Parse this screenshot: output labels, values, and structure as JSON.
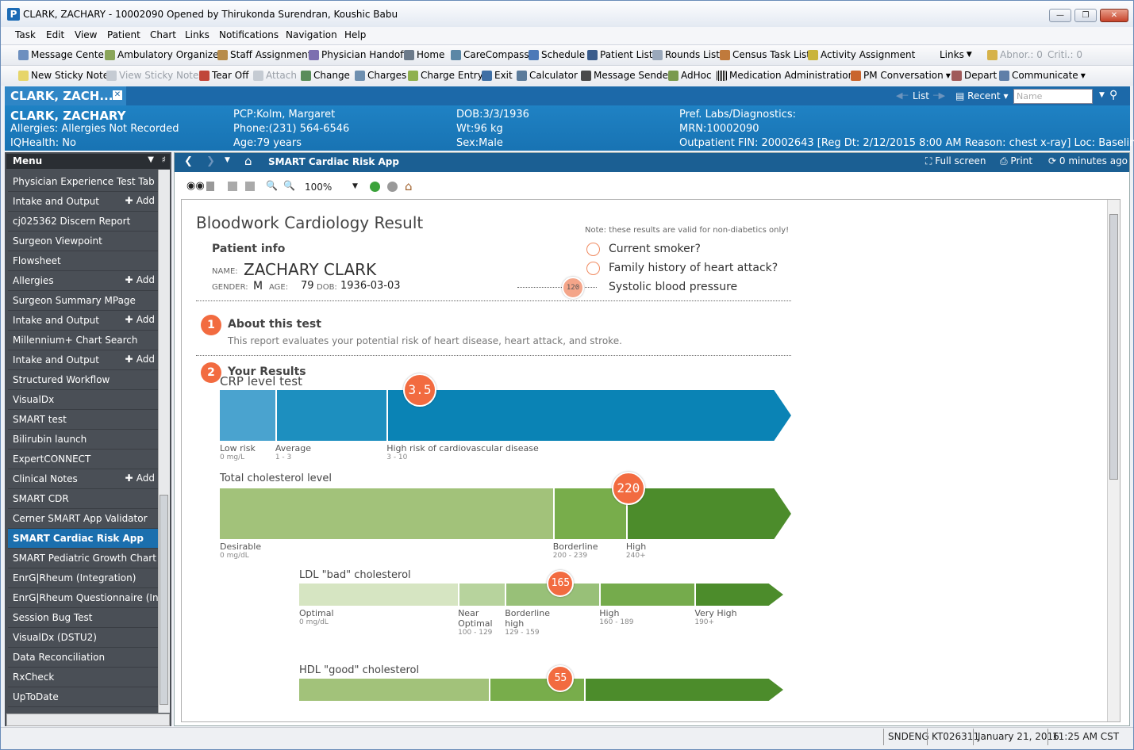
{
  "window": {
    "title": "CLARK, ZACHARY  - 10002090 Opened by Thirukonda Surendran, Koushic Babu",
    "app_icon": "P"
  },
  "menubar": [
    "Task",
    "Edit",
    "View",
    "Patient",
    "Chart",
    "Links",
    "Notifications",
    "Navigation",
    "Help"
  ],
  "toolbar1": [
    "Message Center",
    "Ambulatory Organizer",
    "Staff Assignment",
    "Physician Handoff",
    "Home",
    "CareCompass",
    "Schedule",
    "Patient List",
    "Rounds List",
    "Census Task List",
    "Activity Assignment",
    "Links",
    "Abnor.: 0",
    "Criti.: 0"
  ],
  "toolbar2": [
    "New Sticky Note",
    "View Sticky Notes",
    "Tear Off",
    "Attach",
    "Change",
    "Charges",
    "Charge Entry",
    "Exit",
    "Calculator",
    "Message Sender",
    "AdHoc",
    "Medication Administration",
    "PM Conversation",
    "Depart",
    "Communicate"
  ],
  "patient_tab": {
    "label": "CLARK, ZACH...",
    "list": "List",
    "recent": "Recent",
    "name_placeholder": "Name"
  },
  "banner": {
    "name": "CLARK, ZACHARY",
    "allergies": "Allergies: Allergies Not Recorded",
    "iqhealth": "IQHealth: No",
    "pcp": "PCP:Kolm, Margaret",
    "phone": "Phone:(231) 564-6546",
    "age": "Age:79 years",
    "dob": "DOB:3/3/1936",
    "wt": "Wt:96 kg",
    "sex": "Sex:Male",
    "labs": "Pref. Labs/Diagnostics:",
    "mrn": "MRN:10002090",
    "visit": "Outpatient  FIN: 20002643 [Reg Dt: 2/12/2015 8:00 AM Reason: chest x-ray] Loc: Baseline East"
  },
  "sidebar": {
    "header": "Menu",
    "items": [
      {
        "label": "Physician Experience Test Tab",
        "add": ""
      },
      {
        "label": "Intake and Output",
        "add": "Add"
      },
      {
        "label": "cj025362 Discern Report",
        "add": ""
      },
      {
        "label": "Surgeon Viewpoint",
        "add": ""
      },
      {
        "label": "Flowsheet",
        "add": ""
      },
      {
        "label": "Allergies",
        "add": "Add"
      },
      {
        "label": "Surgeon Summary MPage",
        "add": ""
      },
      {
        "label": "Intake and Output",
        "add": "Add"
      },
      {
        "label": "Millennium+ Chart Search",
        "add": ""
      },
      {
        "label": "Intake and Output",
        "add": "Add"
      },
      {
        "label": "Structured Workflow",
        "add": ""
      },
      {
        "label": "VisualDx",
        "add": ""
      },
      {
        "label": "SMART test",
        "add": ""
      },
      {
        "label": "Bilirubin launch",
        "add": ""
      },
      {
        "label": "ExpertCONNECT",
        "add": ""
      },
      {
        "label": "Clinical Notes",
        "add": "Add"
      },
      {
        "label": "SMART CDR",
        "add": ""
      },
      {
        "label": "Cerner SMART App Validator",
        "add": ""
      },
      {
        "label": "SMART Cardiac Risk App",
        "add": ""
      },
      {
        "label": "SMART Pediatric Growth Chart",
        "add": ""
      },
      {
        "label": "EnrG|Rheum (Integration)",
        "add": ""
      },
      {
        "label": "EnrG|Rheum Questionnaire (Integra",
        "add": ""
      },
      {
        "label": "Session Bug Test",
        "add": ""
      },
      {
        "label": "VisualDx (DSTU2)",
        "add": ""
      },
      {
        "label": "Data Reconciliation",
        "add": ""
      },
      {
        "label": "RxCheck",
        "add": ""
      },
      {
        "label": "UpToDate",
        "add": ""
      }
    ],
    "active_index": 18
  },
  "nav": {
    "title": "SMART Cardiac Risk App",
    "full_screen": "Full screen",
    "print": "Print",
    "updated": "0 minutes ago",
    "zoom": "100%"
  },
  "report": {
    "title": "Bloodwork Cardiology Result",
    "note": "Note: these results are valid for non-diabetics only!",
    "patient_info": "Patient info",
    "name_label": "NAME:",
    "name": "ZACHARY CLARK",
    "gender_label": "GENDER:",
    "gender": "M",
    "age_label": "AGE:",
    "age": "79",
    "dob_label": "DOB:",
    "dob": "1936-03-03",
    "q_smoker": "Current smoker?",
    "q_family": "Family history of heart attack?",
    "q_sbp": "Systolic blood pressure",
    "sbp_value": "120",
    "s1_num": "1",
    "s1_title": "About this test",
    "s1_text": "This report evaluates your potential risk of heart disease, heart attack, and stroke.",
    "s2_num": "2",
    "s2_title": "Your Results"
  },
  "chart_data": [
    {
      "type": "bar",
      "title": "CRP level test",
      "value": 3.5,
      "value_label": "3.5",
      "range": [
        0,
        10
      ],
      "segments": [
        {
          "label": "Low risk",
          "range": "0 mg/L"
        },
        {
          "label": "Average",
          "range": "1 - 3"
        },
        {
          "label": "High risk of cardiovascular disease",
          "range": "3 - 10"
        }
      ],
      "colors": [
        "#4aa3cf",
        "#1d8fbf",
        "#0a83b5"
      ]
    },
    {
      "type": "bar",
      "title": "Total cholesterol level",
      "value": 220,
      "value_label": "220",
      "segments": [
        {
          "label": "Desirable",
          "range": "0 mg/dL"
        },
        {
          "label": "Borderline",
          "range": "200 - 239"
        },
        {
          "label": "High",
          "range": "240+"
        }
      ],
      "colors": [
        "#a2c27a",
        "#78ad4b",
        "#4c8c2b"
      ]
    },
    {
      "type": "bar",
      "title": "LDL \"bad\" cholesterol",
      "value": 165,
      "value_label": "165",
      "segments": [
        {
          "label": "Optimal",
          "range": "0 mg/dL"
        },
        {
          "label": "Near Optimal",
          "range": "100 - 129"
        },
        {
          "label": "Borderline high",
          "range": "129 - 159"
        },
        {
          "label": "High",
          "range": "160 - 189"
        },
        {
          "label": "Very High",
          "range": "190+"
        }
      ],
      "colors": [
        "#d6e5c2",
        "#b7d39d",
        "#98c078",
        "#75ab4c",
        "#4c8c2b"
      ]
    },
    {
      "type": "bar",
      "title": "HDL \"good\" cholesterol",
      "value": 55,
      "value_label": "55",
      "segments": [],
      "colors": [
        "#a2c27a",
        "#78ad4b",
        "#4c8c2b"
      ]
    }
  ],
  "status": {
    "user": "SNDENG",
    "host": "KT026311",
    "date": "January 21, 2016",
    "time": "11:25 AM CST"
  }
}
